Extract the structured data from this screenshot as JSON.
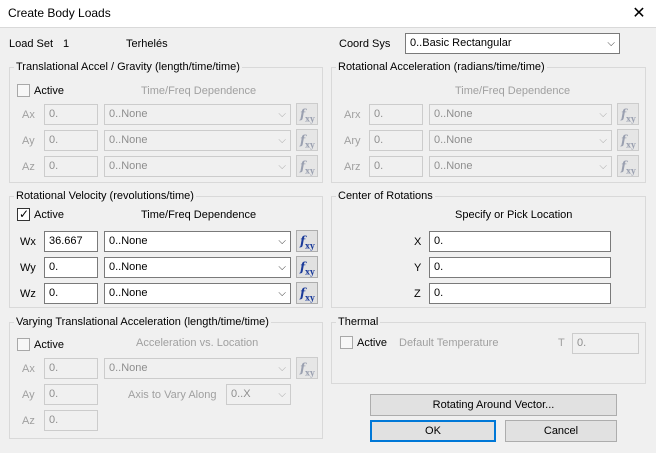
{
  "window": {
    "title": "Create Body Loads"
  },
  "header": {
    "load_set_label": "Load Set",
    "load_set_number": "1",
    "load_set_name": "Terhelés",
    "coord_sys_label": "Coord Sys",
    "coord_sys_value": "0..Basic Rectangular"
  },
  "translational": {
    "title": "Translational Accel / Gravity  (length/time/time)",
    "active_label": "Active",
    "active": false,
    "dependence_label": "Time/Freq Dependence",
    "rows": [
      {
        "label": "Ax",
        "value": "0.",
        "function": "0..None"
      },
      {
        "label": "Ay",
        "value": "0.",
        "function": "0..None"
      },
      {
        "label": "Az",
        "value": "0.",
        "function": "0..None"
      }
    ]
  },
  "rotational_accel": {
    "title": "Rotational Acceleration (radians/time/time)",
    "dependence_label": "Time/Freq Dependence",
    "rows": [
      {
        "label": "Arx",
        "value": "0.",
        "function": "0..None"
      },
      {
        "label": "Ary",
        "value": "0.",
        "function": "0..None"
      },
      {
        "label": "Arz",
        "value": "0.",
        "function": "0..None"
      }
    ]
  },
  "rotational_velocity": {
    "title": "Rotational Velocity (revolutions/time)",
    "active_label": "Active",
    "active": true,
    "dependence_label": "Time/Freq Dependence",
    "rows": [
      {
        "label": "Wx",
        "value": "36.667",
        "function": "0..None"
      },
      {
        "label": "Wy",
        "value": "0.",
        "function": "0..None"
      },
      {
        "label": "Wz",
        "value": "0.",
        "function": "0..None"
      }
    ]
  },
  "center": {
    "title": "Center of Rotations",
    "subtitle": "Specify or Pick Location",
    "rows": [
      {
        "label": "X",
        "value": "0."
      },
      {
        "label": "Y",
        "value": "0."
      },
      {
        "label": "Z",
        "value": "0."
      }
    ]
  },
  "varying": {
    "title": "Varying Translational Acceleration  (length/time/time)",
    "active_label": "Active",
    "active": false,
    "accel_label": "Acceleration vs. Location",
    "axis_label": "Axis to Vary Along",
    "axis_value": "0..X",
    "function": "0..None",
    "rows": [
      {
        "label": "Ax",
        "value": "0."
      },
      {
        "label": "Ay",
        "value": "0."
      },
      {
        "label": "Az",
        "value": "0."
      }
    ]
  },
  "thermal": {
    "title": "Thermal",
    "active_label": "Active",
    "active": false,
    "temp_label": "Default Temperature",
    "t_label": "T",
    "t_value": "0."
  },
  "buttons": {
    "rotating": "Rotating Around Vector...",
    "ok": "OK",
    "cancel": "Cancel"
  },
  "icons": {
    "close": "close-icon",
    "check": "check-icon",
    "dropdown": "chevron-down-icon",
    "function_xy": "function-xy-icon"
  }
}
